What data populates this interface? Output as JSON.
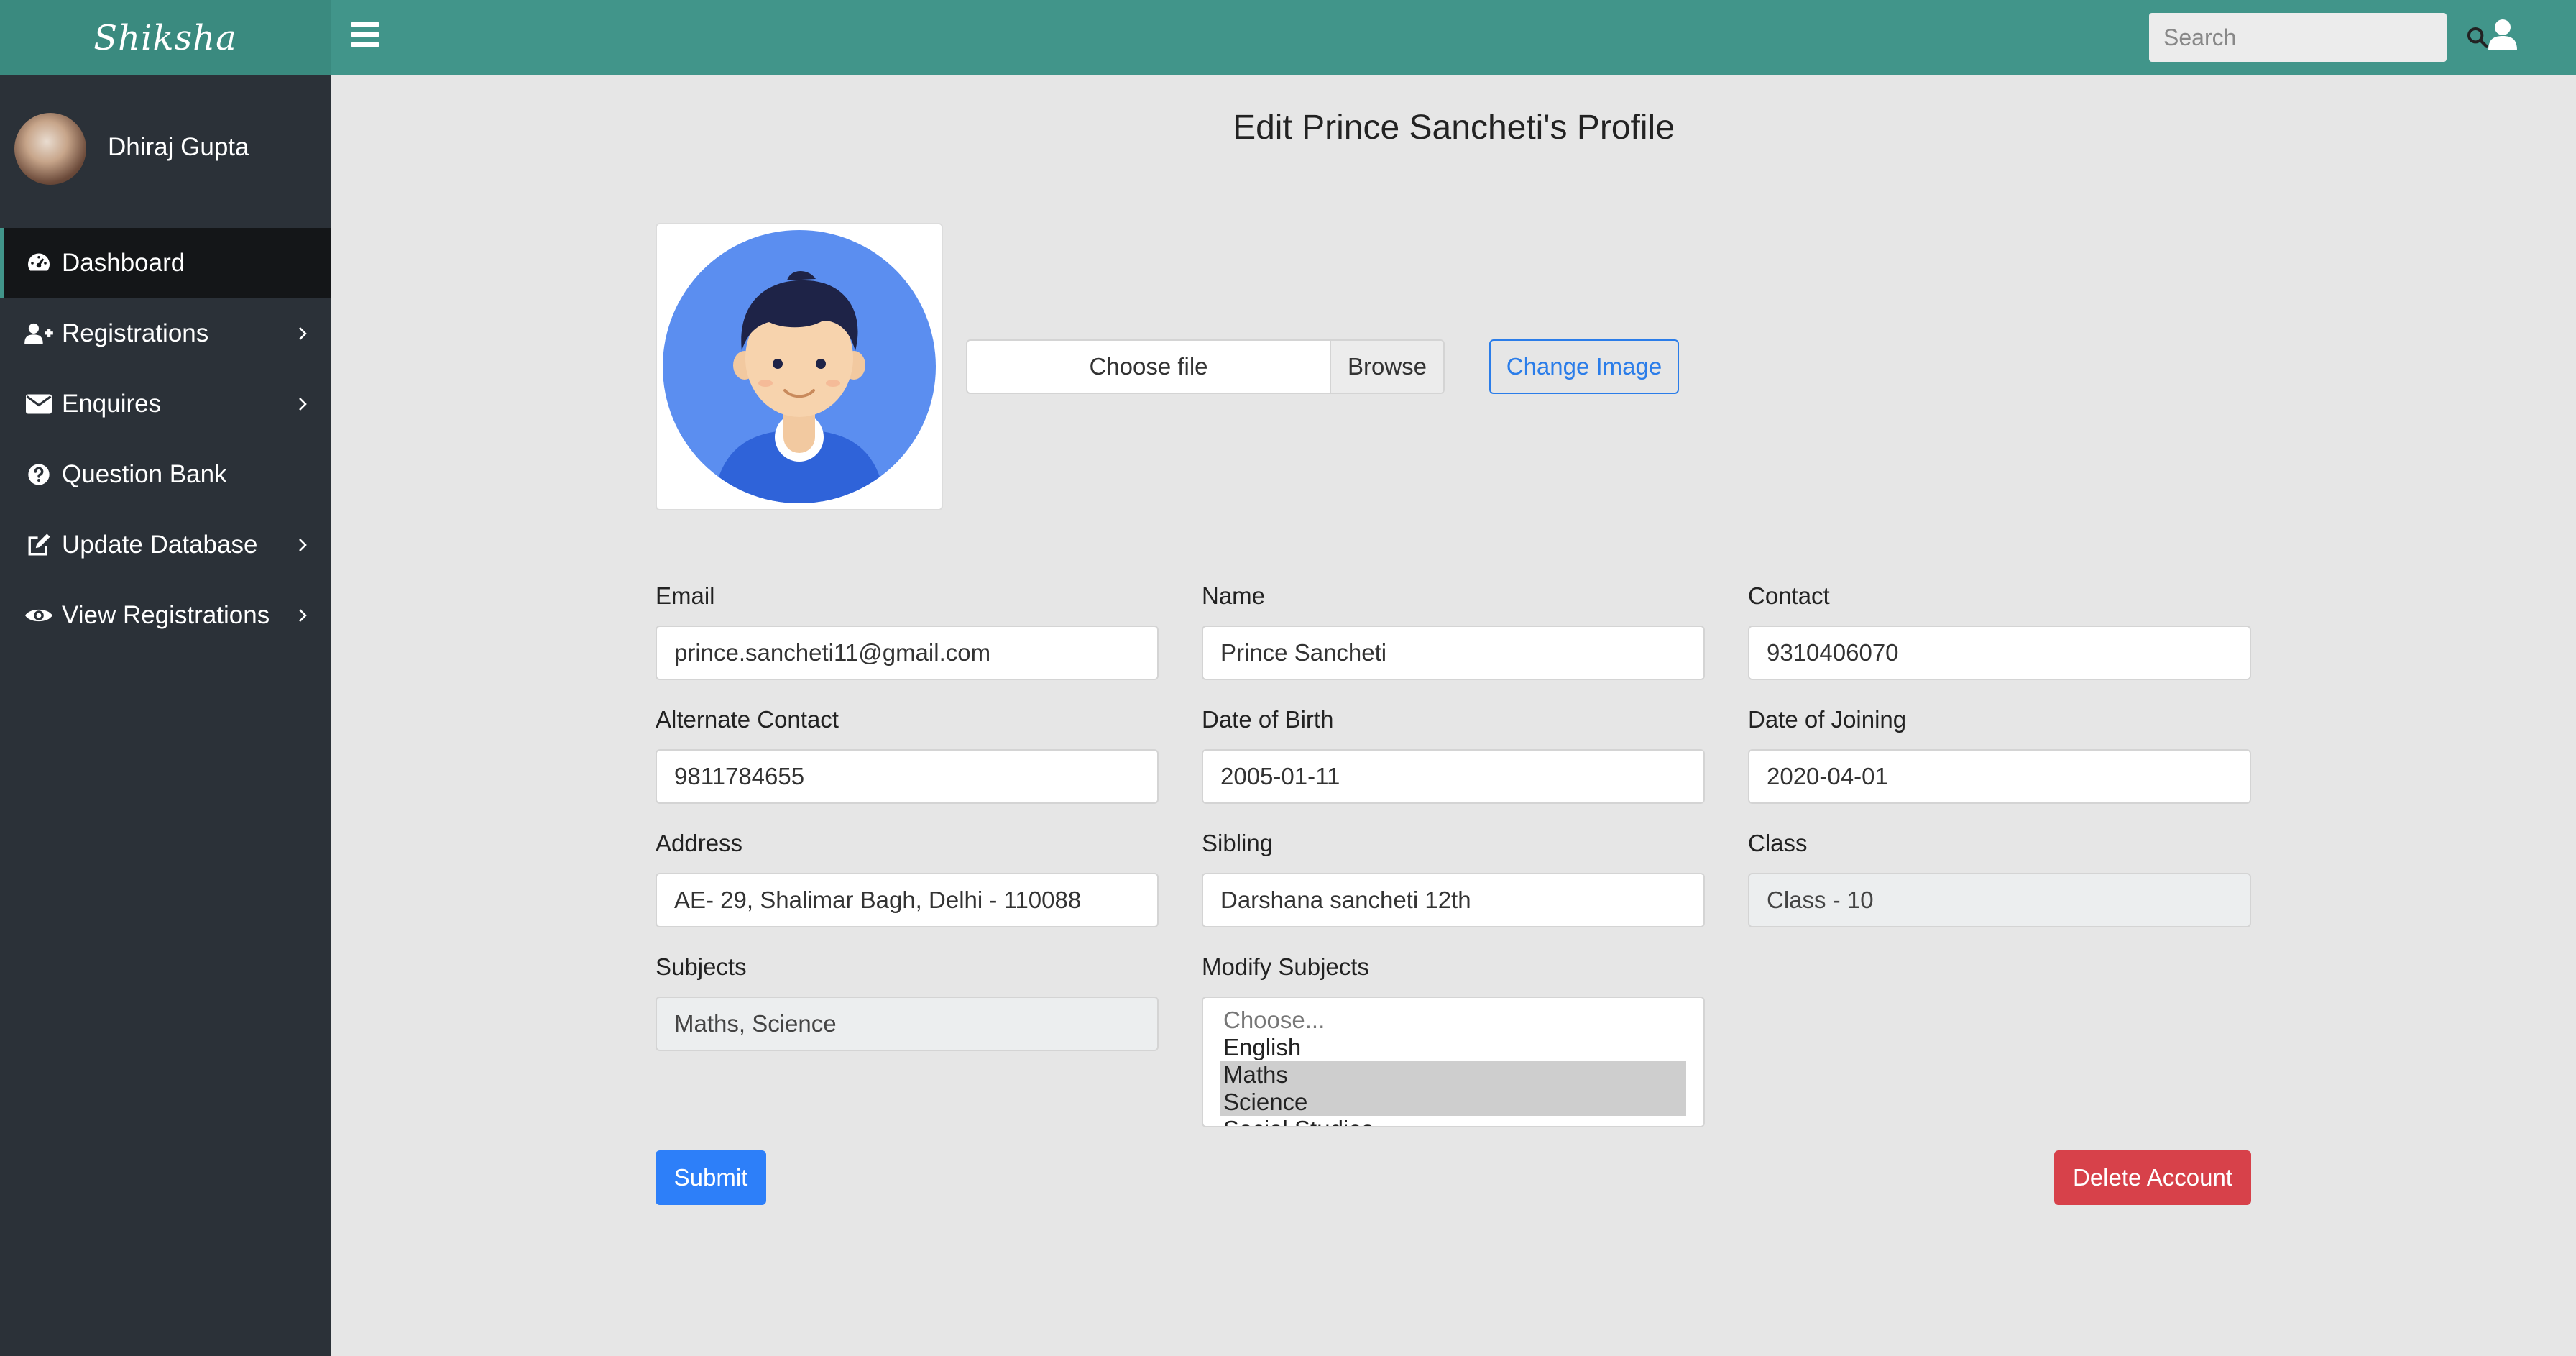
{
  "brand": {
    "name": "Shiksha"
  },
  "search": {
    "placeholder": "Search"
  },
  "user": {
    "name": "Dhiraj Gupta"
  },
  "sidebar": {
    "items": [
      {
        "label": "Dashboard",
        "icon": "dashboard-icon",
        "active": true,
        "has_children": false
      },
      {
        "label": "Registrations",
        "icon": "user-plus-icon",
        "active": false,
        "has_children": true
      },
      {
        "label": "Enquires",
        "icon": "envelope-icon",
        "active": false,
        "has_children": true
      },
      {
        "label": "Question Bank",
        "icon": "question-circle-icon",
        "active": false,
        "has_children": false
      },
      {
        "label": "Update Database",
        "icon": "edit-icon",
        "active": false,
        "has_children": true
      },
      {
        "label": "View Registrations",
        "icon": "eye-icon",
        "active": false,
        "has_children": true
      }
    ]
  },
  "main": {
    "title": "Edit Prince Sancheti's Profile",
    "file_input": {
      "label": "Choose file",
      "browse": "Browse"
    },
    "change_image": "Change Image",
    "fields": {
      "email": {
        "label": "Email",
        "value": "prince.sancheti11@gmail.com"
      },
      "name": {
        "label": "Name",
        "value": "Prince Sancheti"
      },
      "contact": {
        "label": "Contact",
        "value": "9310406070"
      },
      "alt_contact": {
        "label": "Alternate Contact",
        "value": "9811784655"
      },
      "dob": {
        "label": "Date of Birth",
        "value": "2005-01-11"
      },
      "doj": {
        "label": "Date of Joining",
        "value": "2020-04-01"
      },
      "address": {
        "label": "Address",
        "value": "AE- 29, Shalimar Bagh, Delhi - 110088"
      },
      "sibling": {
        "label": "Sibling",
        "value": "Darshana sancheti 12th"
      },
      "class": {
        "label": "Class",
        "value": "Class - 10"
      },
      "subjects": {
        "label": "Subjects",
        "value": "Maths, Science"
      }
    },
    "modify_subjects": {
      "label": "Modify Subjects",
      "options": [
        "Choose...",
        "English",
        "Maths",
        "Science",
        "Social Studies"
      ],
      "selected": [
        "Maths",
        "Science"
      ]
    },
    "submit": "Submit",
    "delete": "Delete Account"
  },
  "colors": {
    "topbar": "#41958a",
    "sidebar": "#2b3138",
    "primary": "#2d7ff9",
    "danger": "#d7414a",
    "background": "#e6e6e6"
  }
}
